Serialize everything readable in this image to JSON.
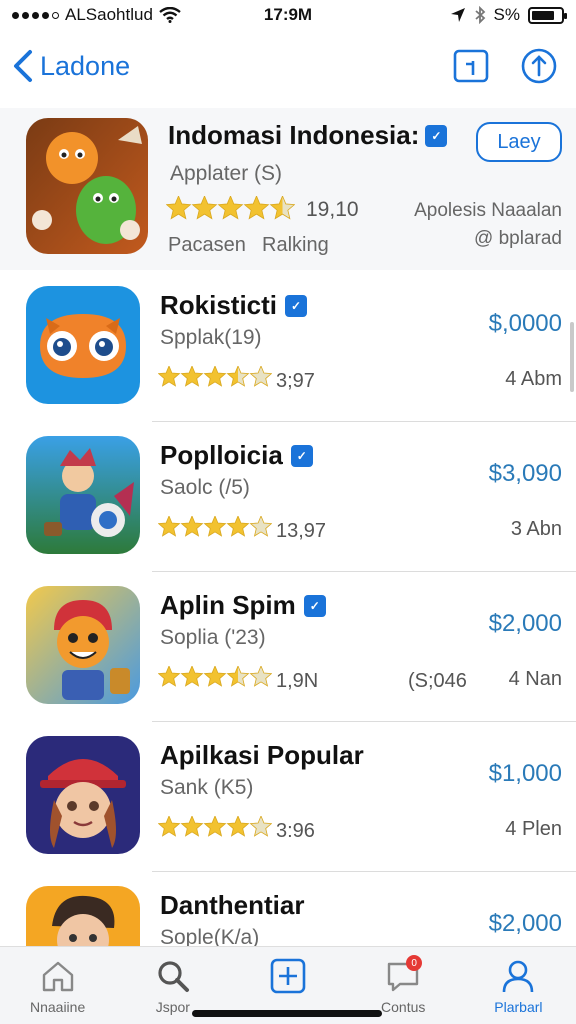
{
  "status": {
    "carrier": "ALSaohtlud",
    "time": "17:9M",
    "battery_label": "S%"
  },
  "nav": {
    "back_label": "Ladone"
  },
  "featured": {
    "title": "Indomasi Indonesia:",
    "verified": "✓",
    "subtitle": "Applater (S)",
    "rating": "19,10",
    "meta_line1": "Apolesis Naaalan",
    "meta_line2": "@ bplarad",
    "tag1": "Pacasen",
    "tag2": "Ralking",
    "button_label": "Laey",
    "stars": 4.5
  },
  "apps": [
    {
      "name": "Rokisticti",
      "verified": "✓",
      "subtitle": "Spplak(19)",
      "rating": "3;97",
      "extra": "",
      "price": "$,0000",
      "count": "4 Abm",
      "stars": 3.5
    },
    {
      "name": "Poplloicia",
      "verified": "✓",
      "subtitle": "Saolc (/5)",
      "rating": "13,97",
      "extra": "",
      "price": "$3,090",
      "count": "3 Abn",
      "stars": 4
    },
    {
      "name": "Aplin Spim",
      "verified": "✓",
      "subtitle": "Soplia ('23)",
      "rating": "1,9N",
      "extra": "(S;046",
      "price": "$2,000",
      "count": "4 Nan",
      "stars": 3.5
    },
    {
      "name": "Apilkasi Popular",
      "verified": "",
      "subtitle": "Sank (K5)",
      "rating": "3:96",
      "extra": "",
      "price": "$1,000",
      "count": "4 Plen",
      "stars": 4
    },
    {
      "name": "Danthentiar",
      "verified": "",
      "subtitle": "Sople(K/a)",
      "rating": "",
      "extra": "",
      "price": "$2,000",
      "count": "",
      "stars": 0
    }
  ],
  "tabs": [
    {
      "label": "Nnaaiine",
      "icon": "home-icon"
    },
    {
      "label": "Jspor",
      "icon": "search-icon"
    },
    {
      "label": "",
      "icon": "plus-icon"
    },
    {
      "label": "Contus",
      "icon": "chat-icon",
      "badge": "0"
    },
    {
      "label": "Plarbarl",
      "icon": "user-icon"
    }
  ],
  "colors": {
    "accent": "#1a73d9",
    "price": "#2a7ab8",
    "star": "#f2c230"
  }
}
